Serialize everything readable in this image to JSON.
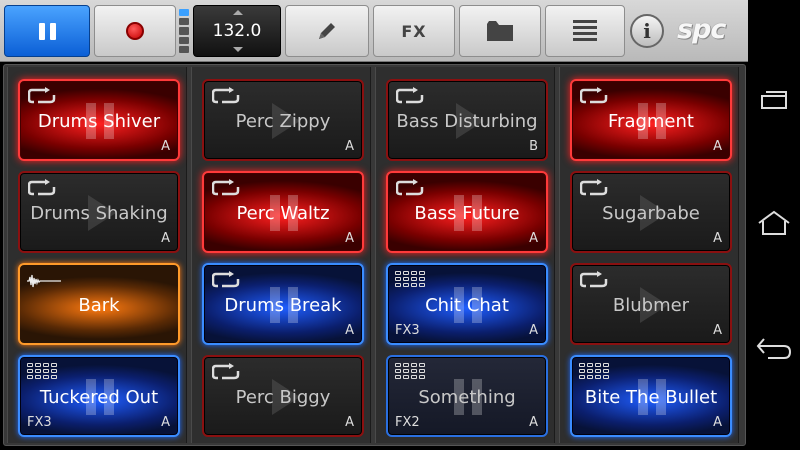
{
  "toolbar": {
    "tempo": "132.0",
    "fx_label": "FX",
    "logo": "spc",
    "info_label": "i",
    "bank_lights": [
      true,
      false,
      false,
      false,
      false
    ]
  },
  "pads": [
    {
      "name": "Drums Shiver",
      "letter": "A",
      "fx": "",
      "state": "red-on",
      "icon": "loop"
    },
    {
      "name": "Perc Zippy",
      "letter": "A",
      "fx": "",
      "state": "red-off",
      "icon": "loop"
    },
    {
      "name": "Bass Disturbing",
      "letter": "B",
      "fx": "",
      "state": "red-off",
      "icon": "loop"
    },
    {
      "name": "Fragment",
      "letter": "A",
      "fx": "",
      "state": "red-on",
      "icon": "loop"
    },
    {
      "name": "Drums Shaking",
      "letter": "A",
      "fx": "",
      "state": "red-off",
      "icon": "loop"
    },
    {
      "name": "Perc Waltz",
      "letter": "A",
      "fx": "",
      "state": "red-on",
      "icon": "loop"
    },
    {
      "name": "Bass Future",
      "letter": "A",
      "fx": "",
      "state": "red-on",
      "icon": "loop"
    },
    {
      "name": "Sugarbabe",
      "letter": "A",
      "fx": "",
      "state": "red-off",
      "icon": "loop"
    },
    {
      "name": "Bark",
      "letter": "",
      "fx": "",
      "state": "orange-on",
      "icon": "wave"
    },
    {
      "name": "Drums Break",
      "letter": "A",
      "fx": "",
      "state": "blue-on",
      "icon": "loop"
    },
    {
      "name": "Chit Chat",
      "letter": "A",
      "fx": "FX3",
      "state": "blue-on",
      "icon": "grid"
    },
    {
      "name": "Blubmer",
      "letter": "A",
      "fx": "",
      "state": "red-off",
      "icon": "loop"
    },
    {
      "name": "Tuckered Out",
      "letter": "A",
      "fx": "FX3",
      "state": "blue-on",
      "icon": "grid"
    },
    {
      "name": "Perc Biggy",
      "letter": "A",
      "fx": "",
      "state": "red-off",
      "icon": "loop"
    },
    {
      "name": "Something",
      "letter": "A",
      "fx": "FX2",
      "state": "blue-off",
      "icon": "grid"
    },
    {
      "name": "Bite The Bullet",
      "letter": "A",
      "fx": "",
      "state": "blue-on",
      "icon": "grid"
    }
  ]
}
